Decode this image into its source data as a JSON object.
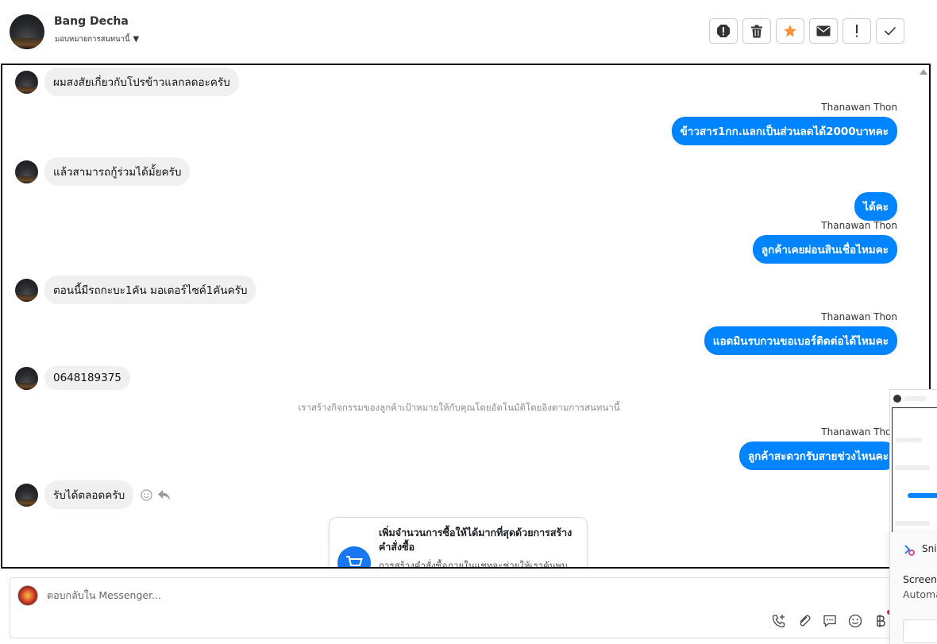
{
  "header": {
    "contact_name": "Bang Decha",
    "assign_label": "มอบหมายการสนทนานี้",
    "actions": [
      "spam-icon",
      "trash-icon",
      "star-icon",
      "envelope-icon",
      "exclamation-icon",
      "check-icon"
    ]
  },
  "messages": [
    {
      "dir": "in",
      "text": "ผมสงสัยเกี่ยวกับโปรข้าวแลกลดอะครับ"
    },
    {
      "dir": "out",
      "sender": "Thanawan Thon",
      "text": "ข้าวสาร1กก.แลกเป็นส่วนลดได้2000บาทคะ"
    },
    {
      "dir": "in",
      "text": "แล้วสามารถกู้ร่วมได้มั้ยครับ"
    },
    {
      "dir": "out",
      "text": "ได้คะ"
    },
    {
      "dir": "out",
      "sender": "Thanawan Thon",
      "text": "ลูกค้าเคยผ่อนสินเชื่อไหมคะ"
    },
    {
      "dir": "in",
      "text": "ตอนนี้มีรถกะบะ1คัน มอเตอร์ไซค์1คันครับ"
    },
    {
      "dir": "out",
      "sender": "Thanawan Thon",
      "text": "แอดมินรบกวนขอเบอร์ติดต่อได้ไหมคะ"
    },
    {
      "dir": "in",
      "text": "0648189375"
    },
    {
      "dir": "out",
      "sender": "Thanawan Thon",
      "text": "ลูกค้าสะดวกรับสายช่วงไหนคะ"
    },
    {
      "dir": "in",
      "text": "รับได้ตลอดครับ"
    }
  ],
  "system_note": "เราสร้างกิจกรรมของลูกค้าเป้าหมายให้กับคุณโดยอัตโนมัติโดยอิงตามการสนทนานี้",
  "order_card": {
    "title": "เพิ่มจำนวนการซื้อให้ได้มากที่สุดด้วยการสร้างคำสั่งซื้อ",
    "description": "การสร้างคำสั่งซื้อภายในแชทจะช่วยให้เราค้นพบ"
  },
  "reply": {
    "placeholder": "ตอบกลับใน Messenger...",
    "tools": [
      "call-add-icon",
      "paperclip-icon",
      "saved-reply-icon",
      "emoji-icon",
      "baht-icon"
    ]
  },
  "snip": {
    "title": "Snip",
    "line1": "Screens",
    "line2": "Automa"
  },
  "colors": {
    "outgoing_bubble": "#0084ff",
    "incoming_bubble": "#f0f0f0",
    "star": "#f7923a"
  }
}
